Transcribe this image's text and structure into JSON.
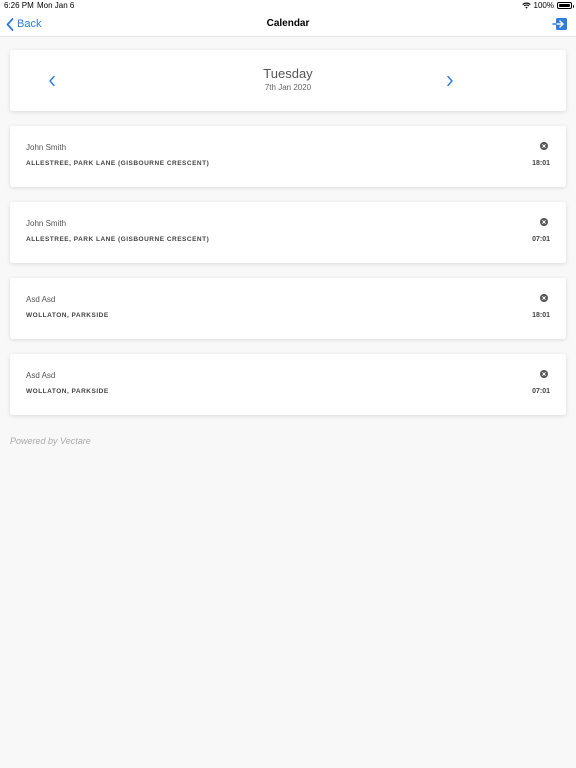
{
  "status_bar": {
    "time": "6:26 PM",
    "date": "Mon Jan 6",
    "battery": "100%"
  },
  "nav": {
    "back_label": "Back",
    "title": "Calendar"
  },
  "date_selector": {
    "day_name": "Tuesday",
    "date": "7th Jan 2020"
  },
  "bookings": [
    {
      "name": "John Smith",
      "location": "ALLESTREE, PARK LANE (GISBOURNE CRESCENT)",
      "time": "18:01"
    },
    {
      "name": "John Smith",
      "location": "ALLESTREE, PARK LANE (GISBOURNE CRESCENT)",
      "time": "07:01"
    },
    {
      "name": "Asd Asd",
      "location": "WOLLATON, PARKSIDE",
      "time": "18:01"
    },
    {
      "name": "Asd Asd",
      "location": "WOLLATON, PARKSIDE",
      "time": "07:01"
    }
  ],
  "footer": {
    "powered_by": "Powered by Vectare"
  },
  "colors": {
    "accent": "#2f7ddc",
    "background": "#f8f8f8",
    "card": "#ffffff"
  },
  "icons": {
    "back": "chevron-left-icon",
    "logout": "logout-icon",
    "prev": "chevron-left-icon",
    "next": "chevron-right-icon",
    "remove": "close-circle-icon",
    "wifi": "wifi-icon",
    "battery": "battery-icon"
  }
}
